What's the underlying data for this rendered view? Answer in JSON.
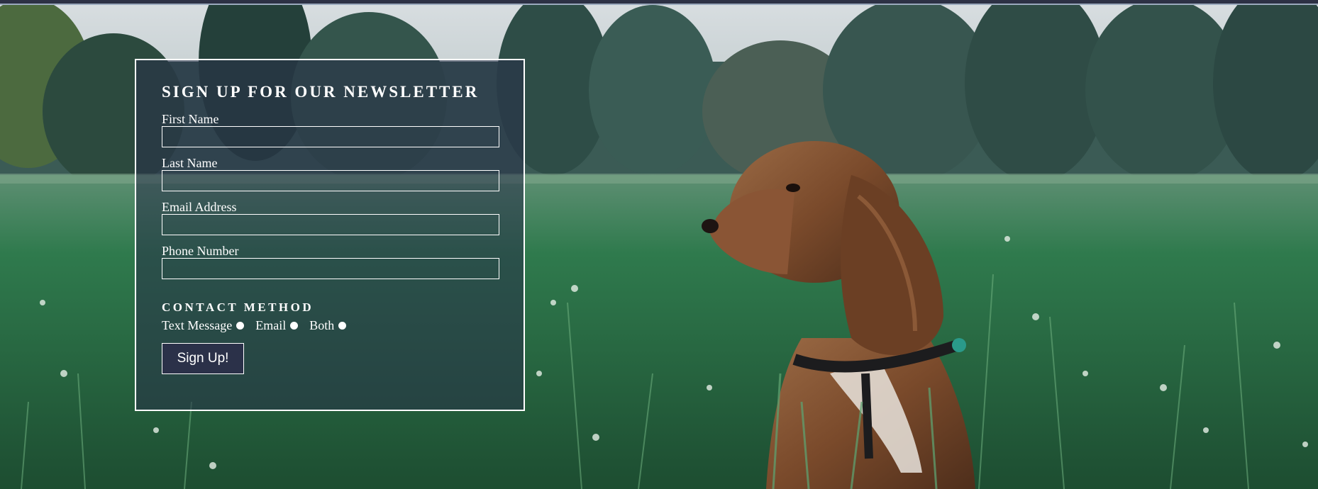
{
  "newsletter": {
    "title": "SIGN UP FOR OUR NEWSLETTER",
    "fields": [
      {
        "label": "First Name",
        "value": "",
        "placeholder": ""
      },
      {
        "label": "Last Name",
        "value": "",
        "placeholder": ""
      },
      {
        "label": "Email Address",
        "value": "",
        "placeholder": ""
      },
      {
        "label": "Phone Number",
        "value": "",
        "placeholder": ""
      }
    ],
    "contact_method": {
      "title": "CONTACT METHOD",
      "options": [
        "Text Message",
        "Email",
        "Both"
      ]
    },
    "submit_label": "Sign Up!"
  },
  "colors": {
    "panel_background": "#283048",
    "button_background": "#2b3149",
    "border": "#ffffff",
    "top_bar": "#2d3145"
  },
  "background": {
    "subject": "spaniel-dog-in-meadow"
  }
}
